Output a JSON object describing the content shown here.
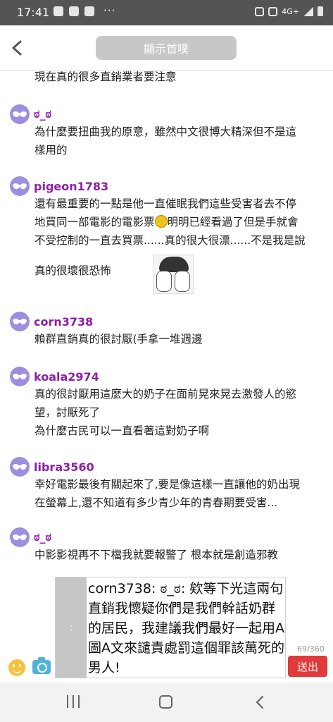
{
  "status_bar": {
    "time": "17:41",
    "dots": "···",
    "network": "4G+"
  },
  "header": {
    "back_icon": "chevron-left-icon",
    "home_button_label": "顯示首噗"
  },
  "messages": [
    {
      "username": "",
      "lines": [
        "現在真的很多直銷業者要注意"
      ]
    },
    {
      "username": "ಠ_ಠ",
      "lines": [
        "為什麼要扭曲我的原意，雖然中文很博大精深但不是這",
        "樣用的"
      ]
    },
    {
      "username": "pigeon1783",
      "lines": [
        "還有最重要的一點是他一直催眠我們這些受害者去不停",
        "地買同一部電影的電影票",
        "明明已經看過了但是手就會",
        "不受控制的一直去買票......真的很大很漂......不是我是說",
        "真的很壞很恐怖"
      ]
    },
    {
      "username": "corn3738",
      "lines": [
        "賴群直銷真的很討厭(手拿一堆週邊"
      ]
    },
    {
      "username": "koala2974",
      "lines": [
        "真的很討厭用這麼大的奶子在面前晃來晃去激發人的慾",
        "望，討厭死了",
        "為什麼古民可以一直看著這對奶子啊"
      ]
    },
    {
      "username": "libra3560",
      "lines": [
        "幸好電影最後有關起來了,要是像這樣一直讓他的奶出現",
        "在螢幕上,還不知道有多少青少年的青春期要受害..."
      ]
    },
    {
      "username": "ಠ_ಠ",
      "lines": [
        "中影影視再不下檔我就要報警了 根本就是創造邪教"
      ]
    }
  ],
  "composer": {
    "handle_label": ":",
    "text": "corn3738: ಠ_ಠ: 欸等下光這兩句直銷我懷疑你們是我們幹話奶群的居民，我建議我們最好一起用A圖A文來譴責處罰這個罪該萬死的男人!",
    "char_count": "69/360",
    "send_label": "送出"
  },
  "colors": {
    "username": "#8e1fa8",
    "avatar": "#9b8fe0",
    "send": "#e03a3a",
    "home_button": "#c7c7c7"
  }
}
